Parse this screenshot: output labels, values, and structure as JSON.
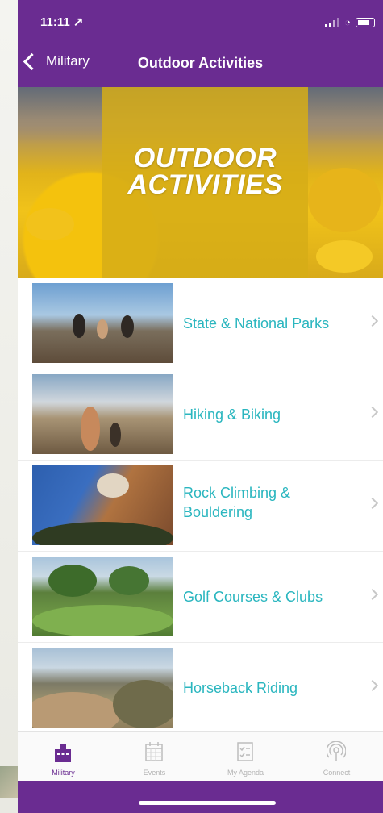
{
  "status_bar": {
    "time": "11:11 ↗"
  },
  "nav": {
    "back_label": "Military",
    "title": "Outdoor Activities"
  },
  "hero": {
    "line1": "OUTDOOR",
    "line2": "ACTIVITIES"
  },
  "list": {
    "items": [
      {
        "label": "State & National Parks",
        "image": "people-on-rocks-photo"
      },
      {
        "label": "Hiking & Biking",
        "image": "hikers-on-ridge-photo"
      },
      {
        "label": "Rock Climbing & Bouldering",
        "image": "climber-on-boulder-photo"
      },
      {
        "label": "Golf Courses & Clubs",
        "image": "golf-course-photo"
      },
      {
        "label": "Horseback Riding",
        "image": "desert-trail-photo"
      }
    ]
  },
  "tabs": [
    {
      "label": "Military",
      "icon": "building-icon",
      "active": true
    },
    {
      "label": "Events",
      "icon": "calendar-icon",
      "active": false
    },
    {
      "label": "My Agenda",
      "icon": "checklist-icon",
      "active": false
    },
    {
      "label": "Connect",
      "icon": "broadcast-icon",
      "active": false
    }
  ],
  "colors": {
    "brand_purple": "#6a2c91",
    "link_teal": "#2ab6bf",
    "hero_yellow": "#d6ad18"
  }
}
